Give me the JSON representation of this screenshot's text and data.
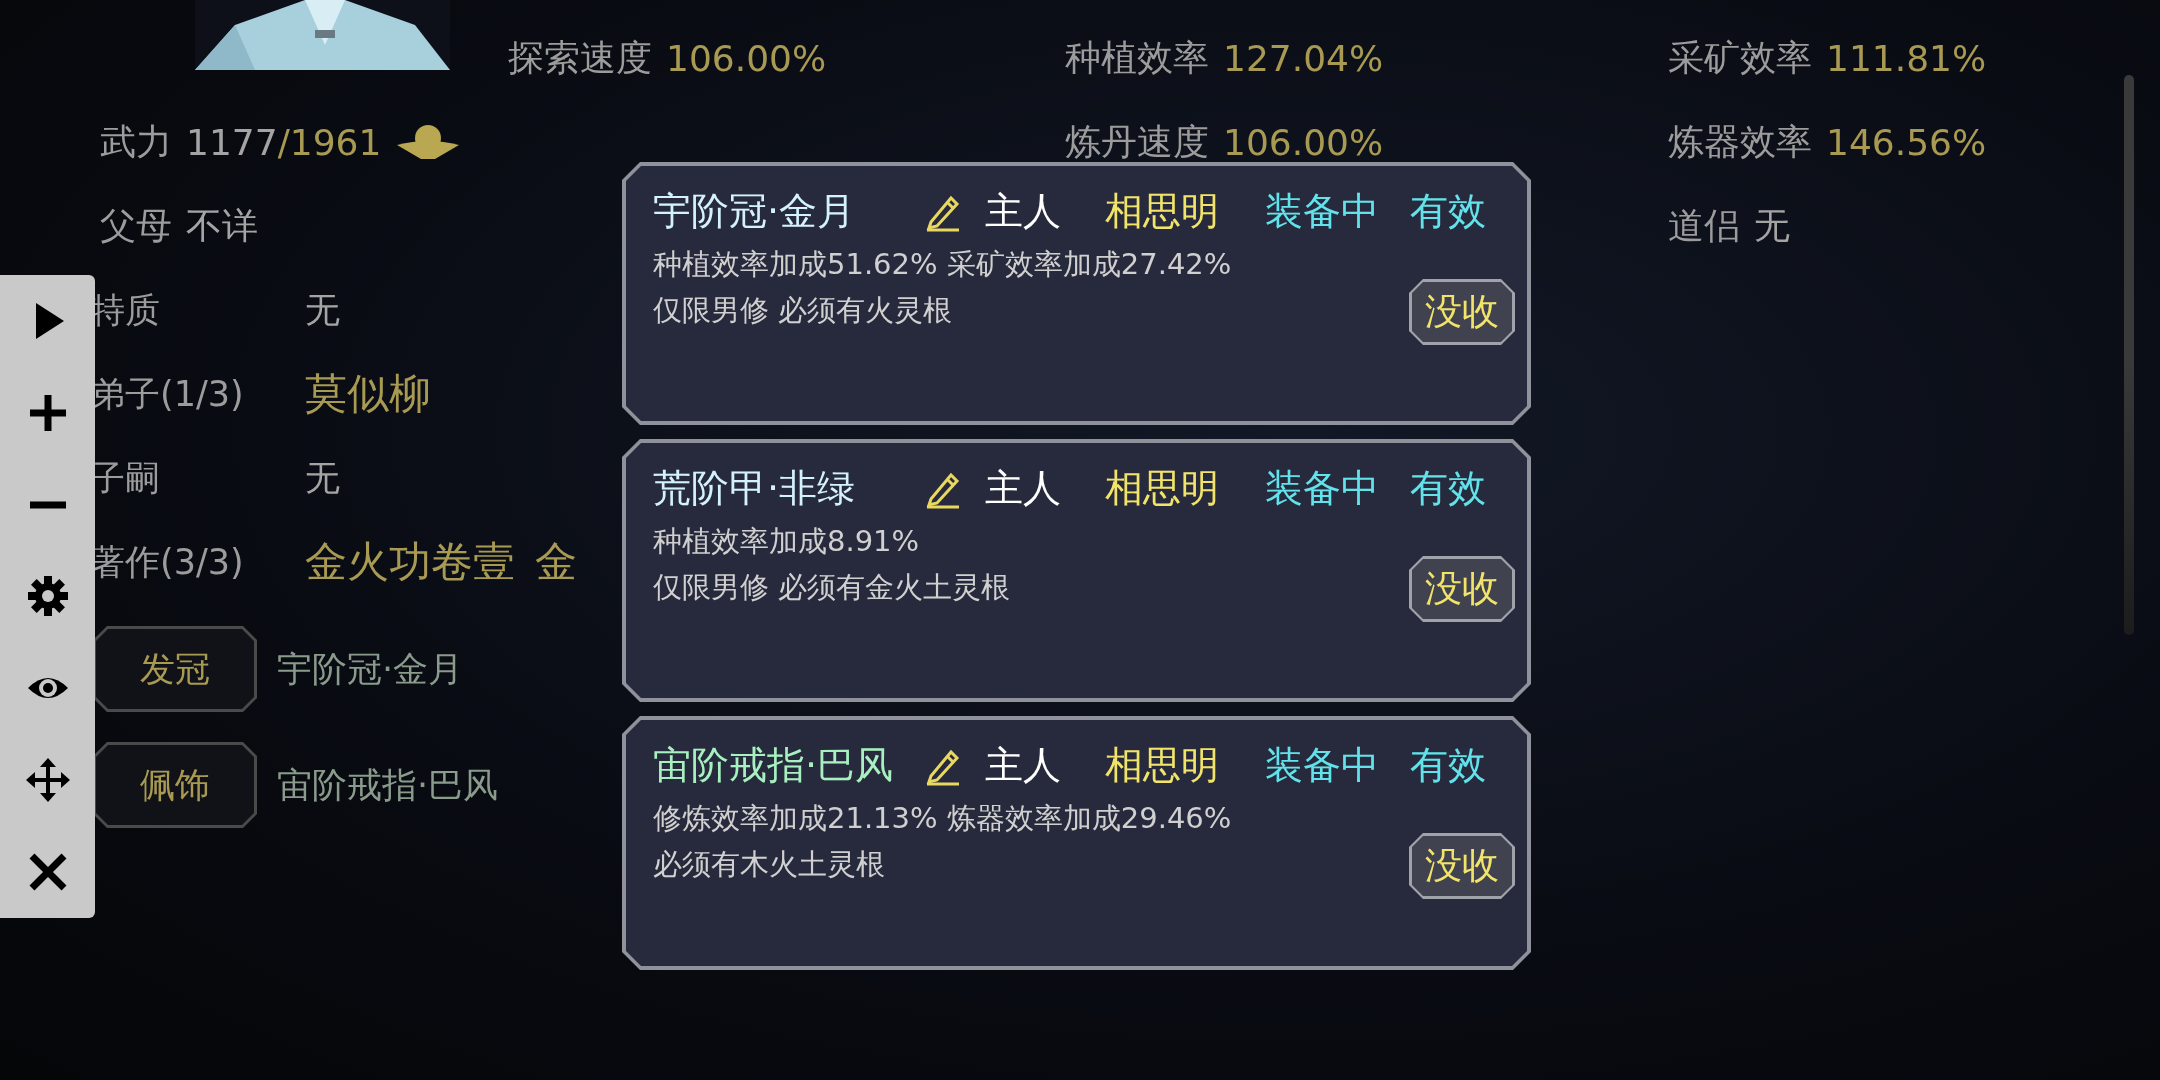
{
  "stat_columns": [
    {
      "items": [
        {
          "kind": "power",
          "label": "武力",
          "value": "1177",
          "max": "/1961"
        },
        {
          "kind": "plain",
          "label": "父母",
          "value": "不详"
        }
      ]
    },
    {
      "items": [
        {
          "kind": "rate",
          "label": "探索速度",
          "value": "106.00%"
        }
      ]
    },
    {
      "items": [
        {
          "kind": "rate",
          "label": "种植效率",
          "value": "127.04%"
        },
        {
          "kind": "rate",
          "label": "炼丹速度",
          "value": "106.00%"
        }
      ]
    },
    {
      "items": [
        {
          "kind": "rate",
          "label": "采矿效率",
          "value": "111.81%"
        },
        {
          "kind": "rate",
          "label": "炼器效率",
          "value": "146.56%"
        },
        {
          "kind": "plain",
          "label": "道侣",
          "value": "无"
        }
      ]
    }
  ],
  "details": [
    {
      "label": "特质",
      "values": [
        {
          "text": "无",
          "kind": "plain"
        }
      ]
    },
    {
      "label": "弟子(1/3)",
      "values": [
        {
          "text": "莫似柳",
          "kind": "highlight"
        }
      ]
    },
    {
      "label": "子嗣",
      "values": [
        {
          "text": "无",
          "kind": "plain"
        }
      ]
    },
    {
      "label": "著作(3/3)",
      "values": [
        {
          "text": "金火功卷壹",
          "kind": "highlight"
        },
        {
          "text": "金",
          "kind": "highlight"
        }
      ]
    }
  ],
  "equipment_slots": [
    {
      "slot": "发冠",
      "item": "宇阶冠·金月"
    },
    {
      "slot": "佩饰",
      "item": "宙阶戒指·巴风"
    }
  ],
  "toolbar": [
    {
      "kind": "play"
    },
    {
      "kind": "plus"
    },
    {
      "kind": "minus"
    },
    {
      "kind": "settings"
    },
    {
      "kind": "view"
    },
    {
      "kind": "move"
    },
    {
      "kind": "close"
    }
  ],
  "item_cards": [
    {
      "name": "宇阶冠·金月",
      "color": "#d4f2fa",
      "owner_label": "主人",
      "owner": "相思明",
      "status": "装备中",
      "validity": "有效",
      "effects": "种植效率加成51.62% 采矿效率加成27.42%",
      "requirements": "仅限男修 必须有火灵根",
      "button": "没收"
    },
    {
      "name": "荒阶甲·非绿",
      "color": "#d4f2fa",
      "owner_label": "主人",
      "owner": "相思明",
      "status": "装备中",
      "validity": "有效",
      "effects": "种植效率加成8.91%",
      "requirements": "仅限男修 必须有金火土灵根",
      "button": "没收"
    },
    {
      "name": "宙阶戒指·巴风",
      "color": "#a8f0c0",
      "owner_label": "主人",
      "owner": "相思明",
      "status": "装备中",
      "validity": "有效",
      "effects": "修炼效率加成21.13% 炼器效率加成29.46%",
      "requirements": "必须有木火土灵根",
      "button": "没收"
    }
  ]
}
